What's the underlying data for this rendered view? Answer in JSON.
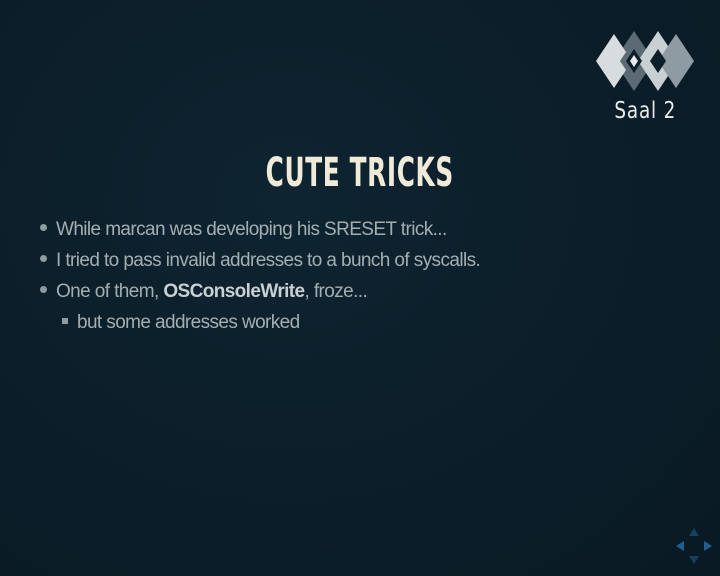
{
  "branding": {
    "room_label": "Saal 2",
    "logo_icon": "ccc-logo-icon"
  },
  "slide": {
    "title": "CUTE TRICKS",
    "bullets": [
      {
        "text": "While marcan was developing his SRESET trick..."
      },
      {
        "text": "I tried to pass invalid addresses to a bunch of syscalls."
      },
      {
        "prefix": "One of them, ",
        "strong": "OSConsoleWrite",
        "suffix": ", froze..."
      }
    ],
    "sub_bullets": [
      {
        "text": "but some addresses worked"
      }
    ]
  },
  "navigation": {
    "icons": [
      "nav-up-icon",
      "nav-left-icon",
      "nav-right-icon",
      "nav-down-icon"
    ]
  },
  "colors": {
    "background": "#0b1e29",
    "title": "#f0ead9",
    "body_text": "#a3aeb1",
    "nav_arrow": "#1f5f93"
  }
}
